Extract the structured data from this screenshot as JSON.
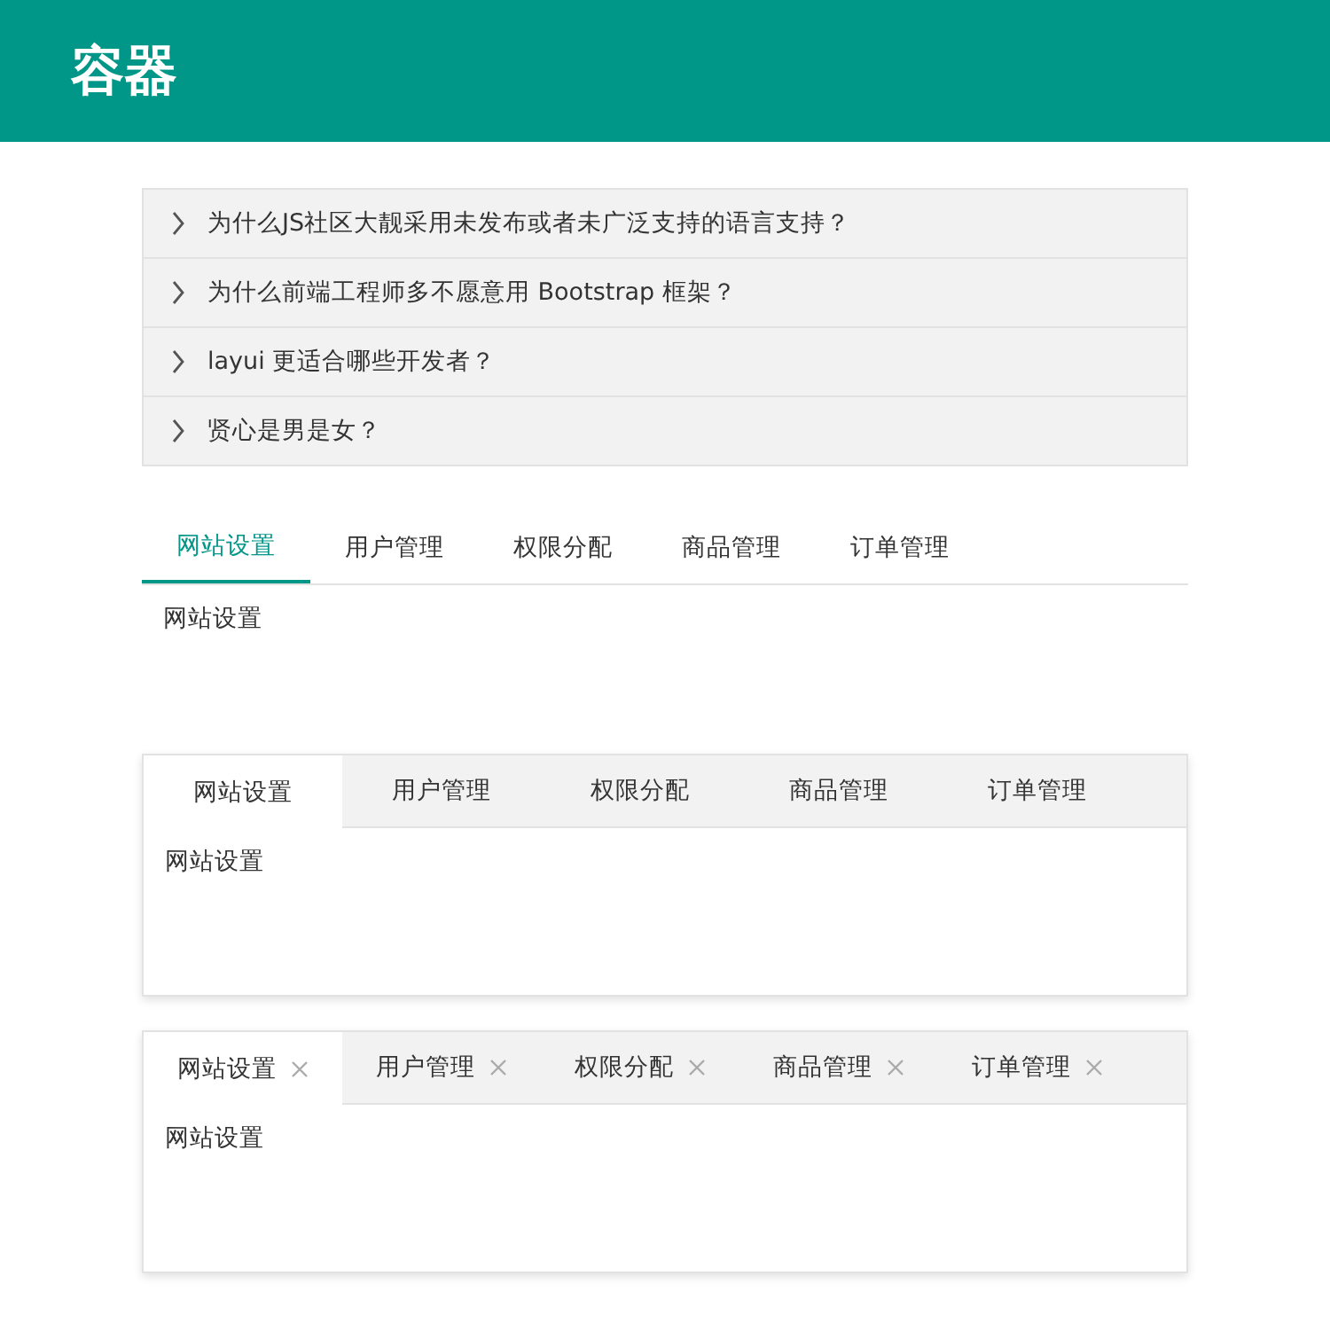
{
  "header": {
    "title": "容器"
  },
  "collapse": {
    "items": [
      {
        "title": "为什么JS社区大靓采用未发布或者未广泛支持的语言支持？",
        "expanded": false
      },
      {
        "title": "为什么前端工程师多不愿意用 Bootstrap 框架？",
        "expanded": false
      },
      {
        "title": "layui 更适合哪些开发者？",
        "expanded": false
      },
      {
        "title": "贤心是男是女？",
        "expanded": false
      }
    ]
  },
  "tab_groups": [
    {
      "kind": "brief",
      "tabs": [
        {
          "label": "网站设置",
          "selected": true
        },
        {
          "label": "用户管理",
          "selected": false
        },
        {
          "label": "权限分配",
          "selected": false
        },
        {
          "label": "商品管理",
          "selected": false
        },
        {
          "label": "订单管理",
          "selected": false
        }
      ],
      "content": "网站设置"
    },
    {
      "kind": "card",
      "tabs": [
        {
          "label": "网站设置",
          "selected": true
        },
        {
          "label": "用户管理",
          "selected": false
        },
        {
          "label": "权限分配",
          "selected": false
        },
        {
          "label": "商品管理",
          "selected": false
        },
        {
          "label": "订单管理",
          "selected": false
        }
      ],
      "content": "网站设置"
    },
    {
      "kind": "card_closable",
      "tabs": [
        {
          "label": "网站设置",
          "selected": true
        },
        {
          "label": "用户管理",
          "selected": false
        },
        {
          "label": "权限分配",
          "selected": false
        },
        {
          "label": "商品管理",
          "selected": false
        },
        {
          "label": "订单管理",
          "selected": false
        }
      ],
      "content": "网站设置"
    }
  ]
}
